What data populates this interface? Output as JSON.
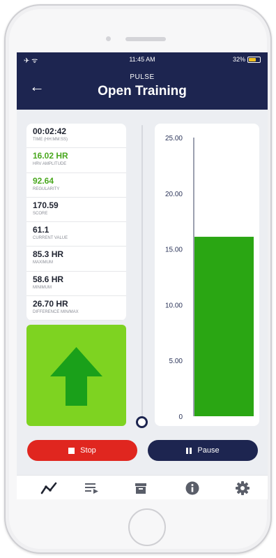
{
  "status_bar": {
    "left_icons": "✈ ᯤ",
    "time": "11:45 AM",
    "battery_percent": "32%",
    "battery_level": 0.32,
    "battery_color": "#f0c020"
  },
  "header": {
    "back_icon": "back-arrow-icon",
    "subtitle": "PULSE",
    "title": "Open Training",
    "background": "#1d2550"
  },
  "stats": [
    {
      "value": "00:02:42",
      "label": "TIME (HH:MM:SS)",
      "highlight": false
    },
    {
      "value": "16.02 HR",
      "label": "HRV AMPLITUDE",
      "highlight": true
    },
    {
      "value": "92.64",
      "label": "REGULARITY",
      "highlight": true
    },
    {
      "value": "170.59",
      "label": "SCORE",
      "highlight": false
    },
    {
      "value": "61.1",
      "label": "CURRENT VALUE",
      "highlight": false
    },
    {
      "value": "85.3 HR",
      "label": "MAXIMUM",
      "highlight": false
    },
    {
      "value": "58.6 HR",
      "label": "MINIMUM",
      "highlight": false
    },
    {
      "value": "26.70 HR",
      "label": "DIFFERENCE MIN/MAX",
      "highlight": false
    }
  ],
  "indicator": {
    "icon": "arrow-up-icon",
    "background": "#7ed321",
    "arrow_color": "#1aa01a"
  },
  "slider": {
    "value": 0
  },
  "chart_data": {
    "type": "bar",
    "categories": [
      ""
    ],
    "values": [
      16.1
    ],
    "ylim": [
      0,
      25
    ],
    "yticks": [
      {
        "value": 25,
        "label": "25.00"
      },
      {
        "value": 20,
        "label": "20.00"
      },
      {
        "value": 15,
        "label": "15.00"
      },
      {
        "value": 10,
        "label": "10.00"
      },
      {
        "value": 5,
        "label": "5.00"
      },
      {
        "value": 0,
        "label": "0"
      }
    ],
    "bar_color": "#2aa613",
    "grid": false
  },
  "buttons": {
    "stop_label": "Stop",
    "stop_icon": "stop-icon",
    "stop_color": "#e0261f",
    "pause_label": "Pause",
    "pause_icon": "pause-icon",
    "pause_color": "#1d2550"
  },
  "tabbar": {
    "items": [
      {
        "icon": "chart-line-icon",
        "selected": true
      },
      {
        "icon": "playlist-icon",
        "selected": false
      },
      {
        "icon": "archive-icon",
        "selected": false
      },
      {
        "icon": "info-icon",
        "selected": false
      },
      {
        "icon": "gear-icon",
        "selected": false
      }
    ]
  }
}
